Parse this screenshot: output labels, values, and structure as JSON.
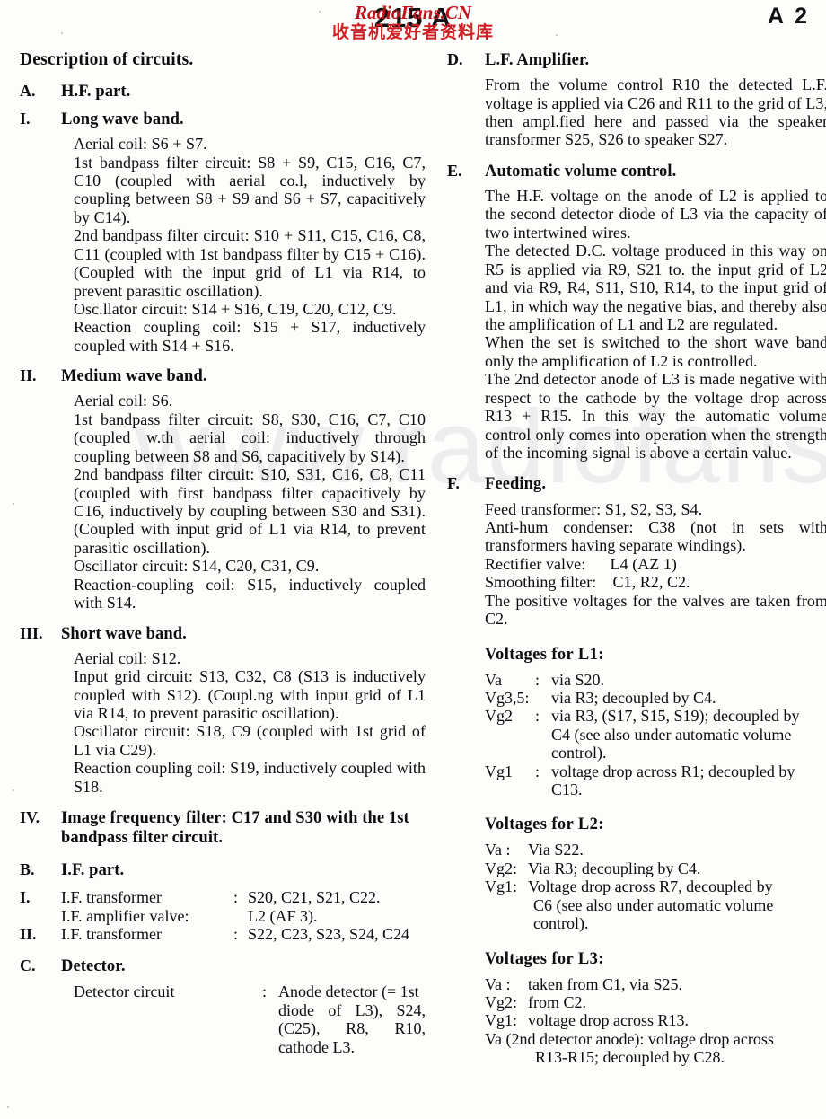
{
  "header": {
    "title": "215 A",
    "page_marker": "A 2",
    "stamp_line1": "RadioFans.CN",
    "stamp_line2": "收音机爱好者资料库",
    "stamp_color": "#c0141c",
    "watermark": "www.radiofans.cn"
  },
  "document": {
    "title": "Description of circuits."
  },
  "left_column": {
    "section_a": {
      "marker": "A.",
      "heading": "H.F. part."
    },
    "sub_i": {
      "marker": "I.",
      "heading": "Long wave band.",
      "paragraphs": [
        "Aerial coil: S6 + S7.",
        "1st bandpass filter circuit: S8 + S9, C15, C16, C7, C10 (coupled with aerial co.l, inductively by coupling between S8 + S9 and S6 + S7, capacitively by C14).",
        "2nd bandpass filter circuit: S10 + S11, C15, C16, C8, C11 (coupled with 1st bandpass filter by C15 + C16). (Coupled with the input grid of L1 via R14, to prevent parasitic oscillation).",
        "Osc.llator circuit: S14 + S16, C19, C20, C12, C9.",
        "Reaction coupling coil: S15 + S17, inductively coupled with S14 + S16."
      ]
    },
    "sub_ii": {
      "marker": "II.",
      "heading": "Medium wave band.",
      "paragraphs": [
        "Aerial coil: S6.",
        "1st bandpass filter circuit: S8, S30, C16, C7, C10 (coupled w.th aerial coil: inductively through coupling between S8 and S6, capacitively by S14).",
        "2nd bandpass filter circuit: S10, S31, C16, C8, C11 (coupled with first bandpass filter capacitively by C16, inductively by coupling between S30 and S31). (Coupled with input grid of L1 via R14, to prevent parasitic oscillation).",
        "Oscillator circuit: S14, C20, C31, C9.",
        "Reaction-coupling coil: S15, inductively coupled with S14."
      ]
    },
    "sub_iii": {
      "marker": "III.",
      "heading": "Short wave band.",
      "paragraphs": [
        "Aerial coil: S12.",
        "Input grid circuit: S13, C32, C8 (S13 is inductively coupled with S12). (Coupl.ng with input grid of L1 via R14, to prevent parasitic oscillation).",
        "Oscillator circuit: S18, C9 (coupled with 1st grid of L1 via C29).",
        "Reaction coupling coil: S19, inductively coupled with S18."
      ]
    },
    "sub_iv": {
      "marker": "IV.",
      "text": "Image frequency filter: C17 and S30 with the 1st bandpass filter circuit."
    },
    "section_b": {
      "marker": "B.",
      "heading": "I.F. part.",
      "rows": [
        {
          "marker": "I.",
          "name": "I.F. transformer",
          "colon": ":",
          "value": "S20, C21, S21, C22."
        },
        {
          "marker": "",
          "name": "I.F. amplifier valve:",
          "colon": "",
          "value": "L2 (AF 3)."
        },
        {
          "marker": "II.",
          "name": "I.F. transformer",
          "colon": ":",
          "value": "S22, C23, S23, S24, C24"
        }
      ]
    },
    "section_c": {
      "marker": "C.",
      "heading": "Detector.",
      "row_name": "Detector circuit",
      "row_colon": ":",
      "row_value": "Anode detector (= 1st",
      "row_cont": "diode of L3), S24, (C25), R8, R10, cathode L3."
    }
  },
  "right_column": {
    "section_d": {
      "marker": "D.",
      "heading": "L.F. Amplifier.",
      "paragraphs": [
        "From the volume control R10 the detected L.F. voltage is applied via C26 and R11 to the grid of L3, then ampl.fied here and passed via the speaker transformer S25, S26 to speaker S27."
      ]
    },
    "section_e": {
      "marker": "E.",
      "heading": "Automatic volume control.",
      "paragraphs": [
        "The H.F. voltage on the anode of L2 is applied to the second detector diode of L3 via the capacity of two intertwined wires.",
        "The detected D.C. voltage produced in this way on R5 is applied via R9, S21 to. the input grid of L2 and via R9, R4, S11, S10, R14, to the input grid of L1, in which way the negative bias, and thereby also the amplification of L1 and L2 are regulated.",
        "When the set is switched to the short wave band only the amplification of L2 is controlled.",
        "The 2nd detector anode of L3 is made negative with respect to the cathode by the voltage drop across R13 + R15. In this way the automatic volume control only comes into operation when the strength of the incoming signal is above a certain value."
      ]
    },
    "section_f": {
      "marker": "F.",
      "heading": "Feeding.",
      "paragraphs": [
        "Feed transformer: S1, S2, S3, S4.",
        "Anti-hum condenser: C38 (not in sets with transformers having separate windings).",
        "Rectifier valve:      L4 (AZ 1)",
        "Smoothing filter:    C1, R2, C2.",
        "The positive voltages for the valves are taken from C2."
      ]
    },
    "voltages_l1": {
      "heading": "Voltages for L1:",
      "rows": [
        {
          "label": "Va",
          "colon": ": ",
          "value": "via S20."
        },
        {
          "label": "Vg3,5:",
          "colon": "",
          "value": "via R3; decoupled by C4."
        },
        {
          "label": "Vg2",
          "colon": ": ",
          "value": "via R3, (S17, S15, S19); decoupled by"
        }
      ],
      "cont_1": "C4 (see also under automatic volume",
      "cont_2": "control).",
      "row_vg1_label": "Vg1",
      "row_vg1_colon": ": ",
      "row_vg1_value": "voltage drop across R1; decoupled by",
      "cont_3": "C13."
    },
    "voltages_l2": {
      "heading": "Voltages for L2:",
      "rows": [
        {
          "label": "Va :",
          "value": "Via S22."
        },
        {
          "label": "Vg2:",
          "value": "Via R3; decoupling by C4."
        },
        {
          "label": "Vg1:",
          "value": "Voltage drop across R7, decoupled by"
        }
      ],
      "cont_1": "C6 (see also under automatic volume",
      "cont_2": "control)."
    },
    "voltages_l3": {
      "heading": "Voltages for L3:",
      "rows": [
        {
          "label": "Va :",
          "value": "taken from C1, via S25."
        },
        {
          "label": "Vg2:",
          "value": "from C2."
        },
        {
          "label": "Vg1:",
          "value": "voltage drop across R13."
        }
      ],
      "last_line": "Va (2nd detector anode): voltage drop across",
      "last_cont": "R13-R15; decoupled by C28."
    }
  }
}
